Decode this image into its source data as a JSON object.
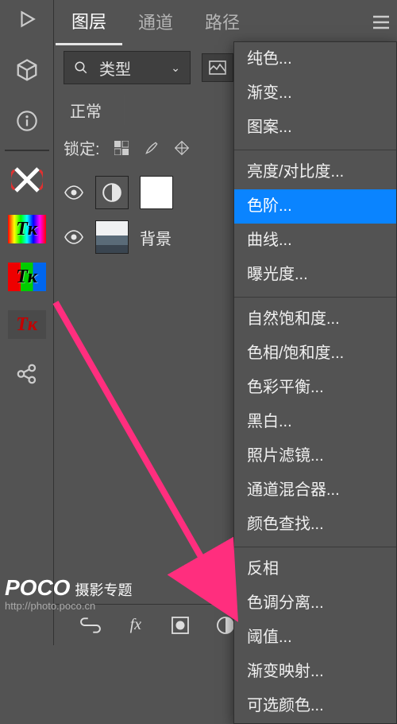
{
  "panel": {
    "tabs": [
      "图层",
      "通道",
      "路径"
    ],
    "active_tab": 0
  },
  "filter": {
    "label": "类型"
  },
  "blend_mode": "正常",
  "lock_label": "锁定:",
  "layers": [
    {
      "name": "背景"
    }
  ],
  "menu": {
    "groups": [
      [
        "纯色...",
        "渐变...",
        "图案..."
      ],
      [
        "亮度/对比度...",
        "色阶...",
        "曲线...",
        "曝光度..."
      ],
      [
        "自然饱和度...",
        "色相/饱和度...",
        "色彩平衡...",
        "黑白...",
        "照片滤镜...",
        "通道混合器...",
        "颜色查找..."
      ],
      [
        "反相",
        "色调分离...",
        "阈值...",
        "渐变映射...",
        "可选颜色..."
      ]
    ],
    "highlighted": "色阶..."
  },
  "watermark": {
    "brand1": "POCO",
    "brand2": "摄影专题",
    "url": "http://photo.poco.cn"
  }
}
